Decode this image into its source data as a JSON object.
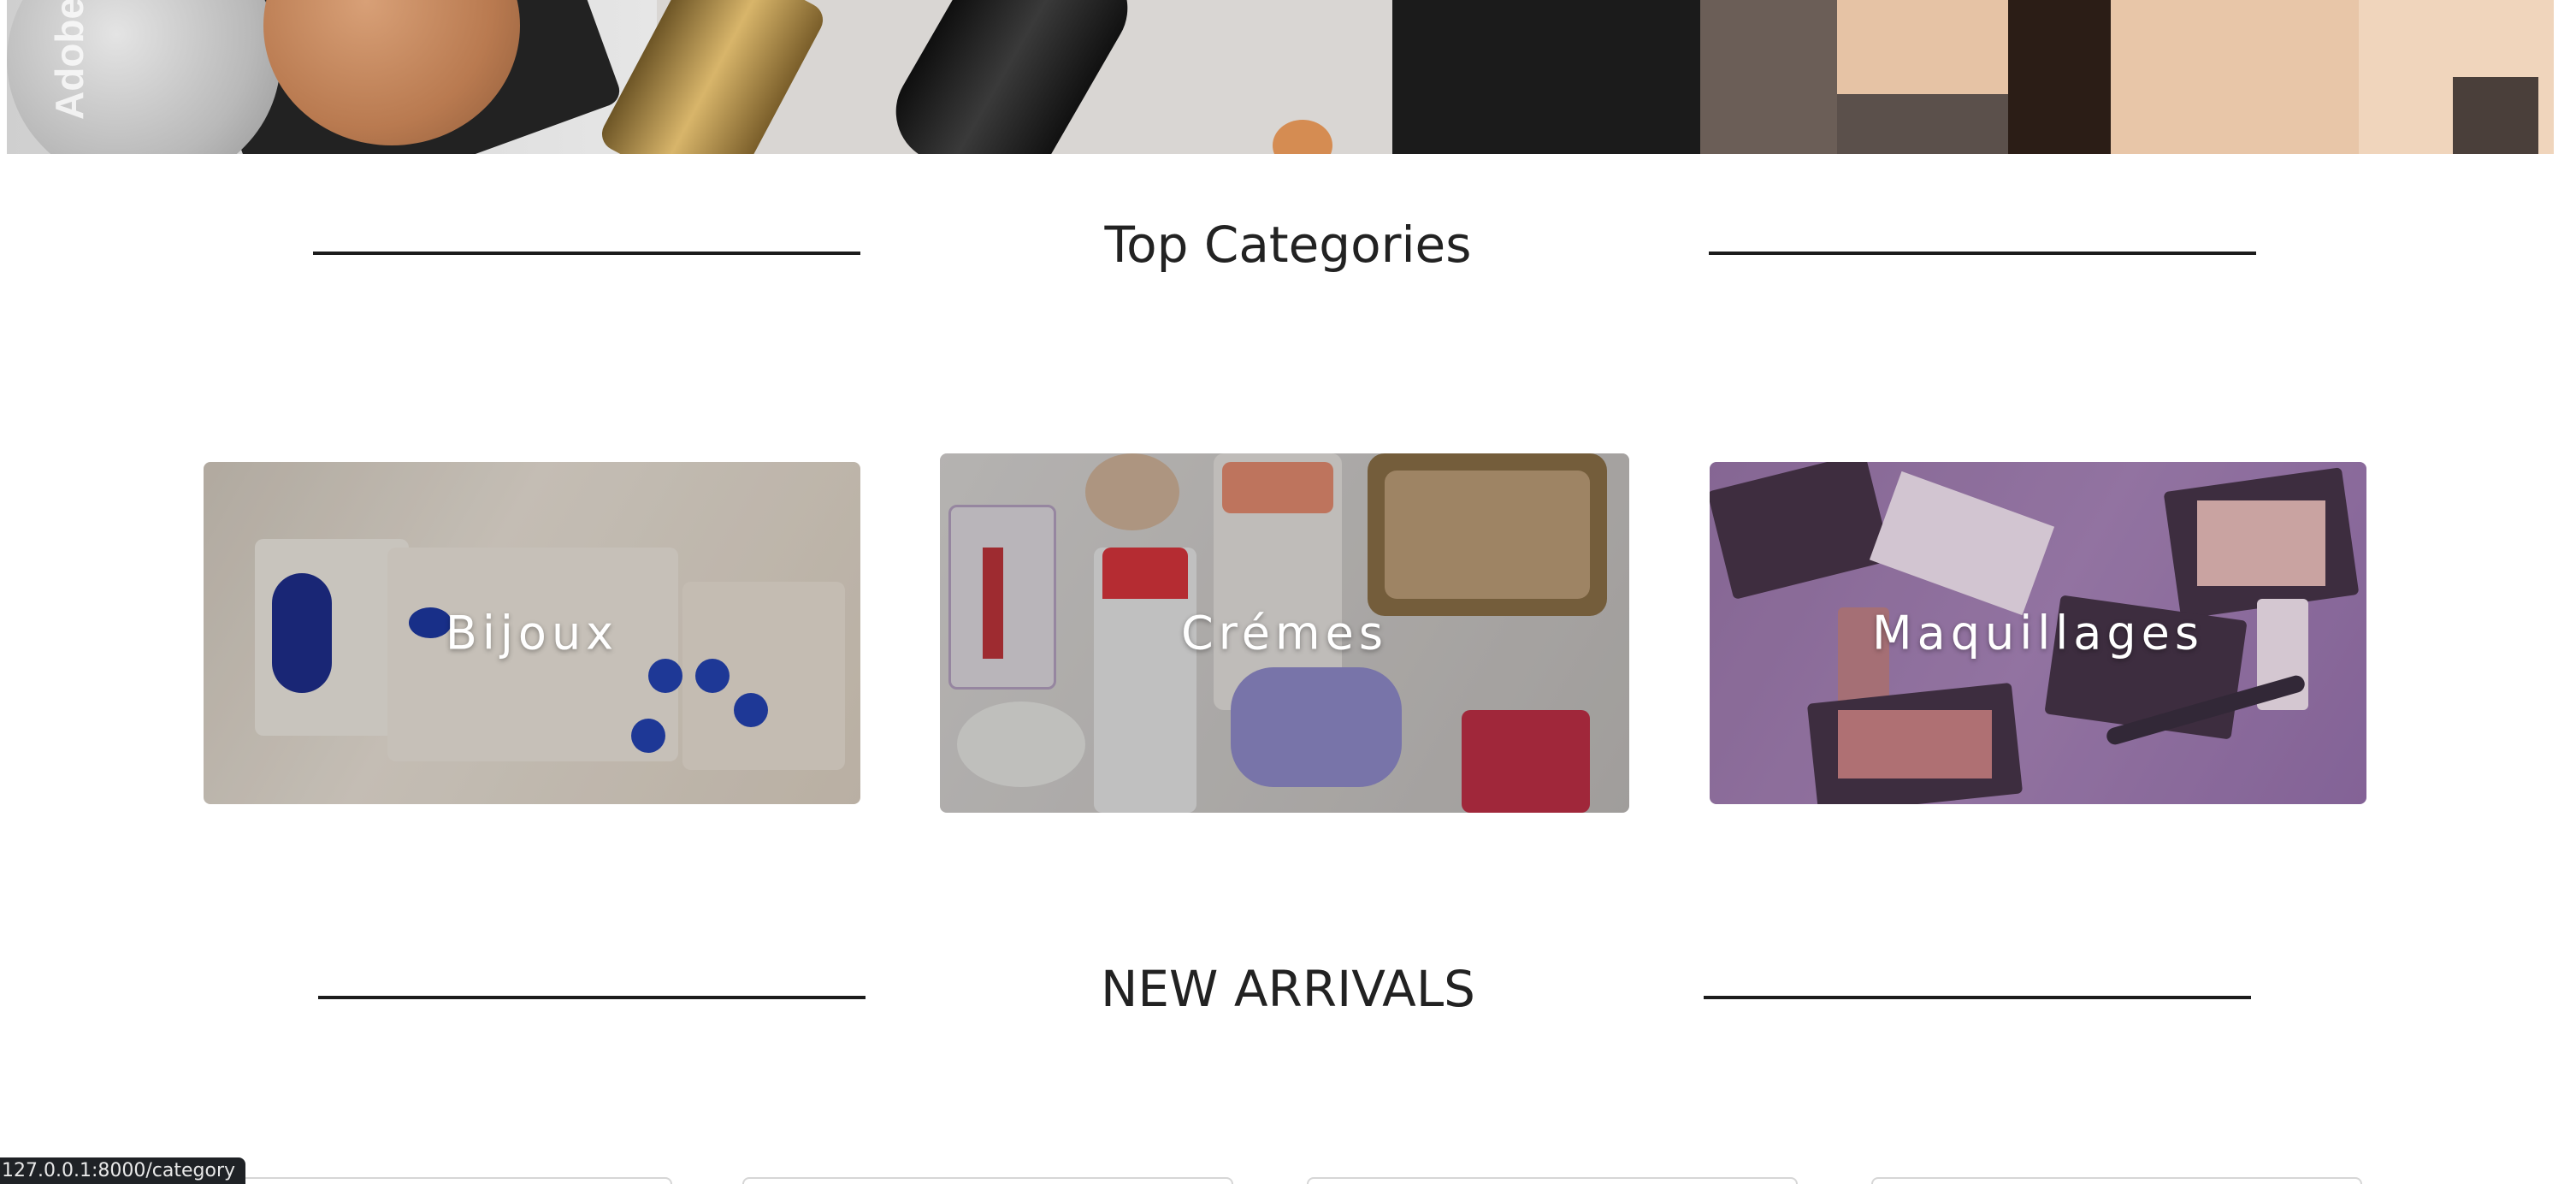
{
  "hero": {
    "watermark": "Adobe"
  },
  "top_categories": {
    "title": "Top Categories",
    "cards": [
      {
        "label": "Bijoux"
      },
      {
        "label": "Crémes"
      },
      {
        "label": "Maquillages"
      }
    ]
  },
  "new_arrivals": {
    "title": "NEW ARRIVALS"
  },
  "status_bar": {
    "url": "127.0.0.1:8000/category"
  }
}
